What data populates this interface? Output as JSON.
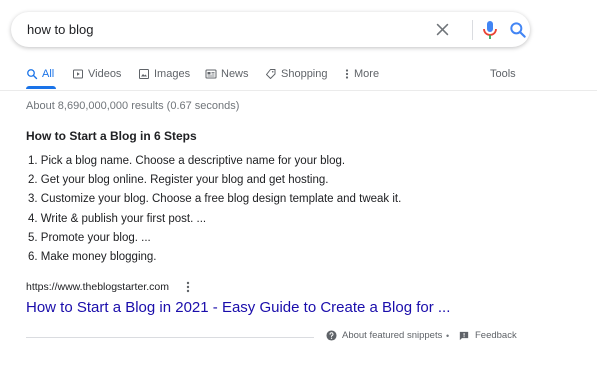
{
  "search": {
    "query": "how to blog"
  },
  "tabs": [
    {
      "label": "All",
      "icon": "search-icon"
    },
    {
      "label": "Videos",
      "icon": "video-icon"
    },
    {
      "label": "Images",
      "icon": "image-icon"
    },
    {
      "label": "News",
      "icon": "news-icon"
    },
    {
      "label": "Shopping",
      "icon": "tag-icon"
    },
    {
      "label": "More",
      "icon": "more-vertical-icon"
    }
  ],
  "tools_label": "Tools",
  "result_stats": "About 8,690,000,000 results (0.67 seconds)",
  "featured_snippet": {
    "title": "How to Start a Blog in 6 Steps",
    "steps": [
      "1. Pick a blog name. Choose a descriptive name for your blog.",
      "2. Get your blog online. Register your blog and get hosting.",
      "3. Customize your blog. Choose a free blog design template and tweak it.",
      "4. Write & publish your first post. ...",
      "5. Promote your blog. ...",
      "6. Make money blogging."
    ],
    "source_url": "https://www.theblogstarter.com",
    "link_title": "How to Start a Blog in 2021 - Easy Guide to Create a Blog for ...",
    "about_label": "About featured snippets",
    "separator": "•",
    "feedback_label": "Feedback"
  },
  "colors": {
    "accent": "#1a73e8",
    "link": "#1a0dab",
    "mic_blue": "#4285f4",
    "mic_red": "#ea4335"
  }
}
